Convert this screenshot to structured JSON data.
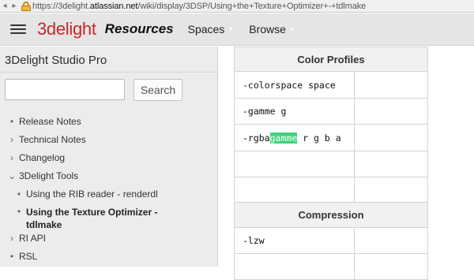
{
  "browser": {
    "url_prefix": "https://3delight.",
    "url_domain": "atlassian.net",
    "url_path": "/wiki/display/3DSP/Using+the+Texture+Optimizer+-+tdlmake"
  },
  "header": {
    "logo": "3delight",
    "resources": "Resources",
    "menu": [
      "Spaces",
      "Browse"
    ]
  },
  "sidebar": {
    "title": "3Delight Studio Pro",
    "search_label": "Search",
    "search_value": "",
    "items": [
      {
        "marker": "•",
        "label": "Release Notes"
      },
      {
        "marker": "›",
        "label": "Technical Notes"
      },
      {
        "marker": "›",
        "label": "Changelog"
      },
      {
        "marker": "⌄",
        "label": "3Delight Tools"
      },
      {
        "marker": "•",
        "label": "Using the RIB reader - renderdl"
      },
      {
        "marker": "•",
        "label": "Using the Texture Optimizer -",
        "label2": "tdlmake"
      },
      {
        "marker": "›",
        "label": "RI API"
      },
      {
        "marker": "•",
        "label": "RSL"
      }
    ]
  },
  "content": {
    "section1": {
      "heading": "Color Profiles",
      "rows": [
        {
          "code": "-colorspace space"
        },
        {
          "code": "-gamme g"
        },
        {
          "code_pre": "-rgba",
          "code_hl": "gamme",
          "code_post": " r g b a"
        },
        {
          "code": ""
        },
        {
          "code": ""
        }
      ]
    },
    "section2": {
      "heading": "Compression",
      "rows": [
        {
          "code": "-lzw"
        },
        {
          "code": ""
        }
      ]
    }
  }
}
